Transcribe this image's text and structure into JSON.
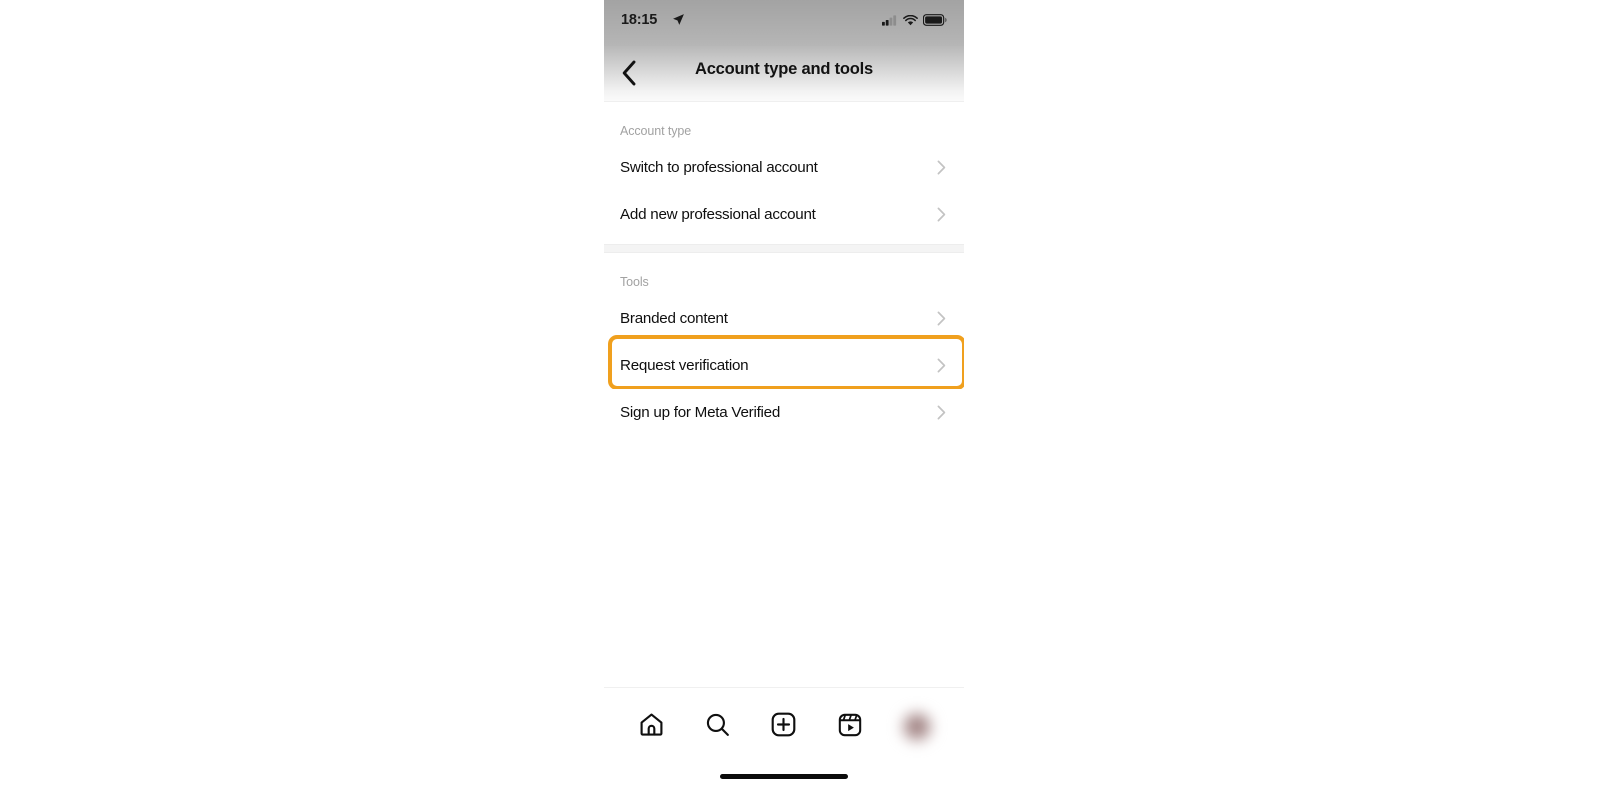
{
  "status_bar": {
    "time": "18:15",
    "location_icon": "location-arrow-icon",
    "cellular_icon": "cellular-signal-icon",
    "wifi_icon": "wifi-icon",
    "battery_icon": "battery-icon"
  },
  "header": {
    "back_icon": "chevron-left-icon",
    "title": "Account type and tools"
  },
  "sections": [
    {
      "header": "Account type",
      "rows": [
        {
          "label": "Switch to professional account",
          "chevron": "chevron-right-icon"
        },
        {
          "label": "Add new professional account",
          "chevron": "chevron-right-icon"
        }
      ]
    },
    {
      "header": "Tools",
      "rows": [
        {
          "label": "Branded content",
          "chevron": "chevron-right-icon"
        },
        {
          "label": "Request verification",
          "chevron": "chevron-right-icon",
          "highlighted": true
        },
        {
          "label": "Sign up for Meta Verified",
          "chevron": "chevron-right-icon"
        }
      ]
    }
  ],
  "highlight": {
    "color": "#f0a01e",
    "target": "Request verification"
  },
  "tab_bar": {
    "items": [
      {
        "icon": "home-icon"
      },
      {
        "icon": "search-icon"
      },
      {
        "icon": "add-post-icon"
      },
      {
        "icon": "reels-icon"
      },
      {
        "icon": "profile-avatar"
      }
    ],
    "home_indicator": "home-indicator-bar"
  },
  "colors": {
    "accent_highlight": "#f0a01e",
    "text_primary": "#0f0f0f",
    "text_muted": "#a2a2a2",
    "chevron": "#c3c3c3",
    "background": "#ffffff"
  }
}
